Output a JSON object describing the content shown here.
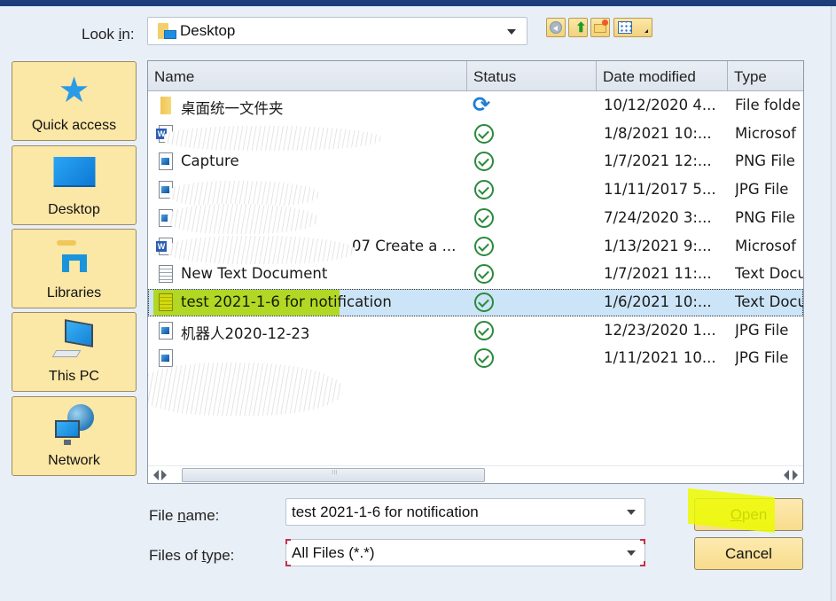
{
  "dialog": {
    "look_in": {
      "label_pre": "Look ",
      "label_u": "i",
      "label_post": "n:",
      "value": "Desktop",
      "icon": "desktop-folder-icon"
    },
    "toolbar": {
      "back_icon": "back-icon",
      "up_icon": "up-folder-icon",
      "new_folder_icon": "new-folder-icon",
      "view_menu_icon": "view-menu-icon"
    },
    "places": [
      {
        "label": "Quick access",
        "icon": "star-icon"
      },
      {
        "label": "Desktop",
        "icon": "desktop-icon"
      },
      {
        "label": "Libraries",
        "icon": "libraries-icon"
      },
      {
        "label": "This PC",
        "icon": "computer-icon"
      },
      {
        "label": "Network",
        "icon": "network-icon"
      }
    ],
    "columns": [
      "Name",
      "Status",
      "Date modified",
      "Type"
    ],
    "files": [
      {
        "name": "桌面统一文件夹",
        "icon": "folder",
        "status": "sync",
        "date": "10/12/2020 4...",
        "type": "File folde",
        "redacted": false
      },
      {
        "name": "",
        "icon": "doc",
        "status": "ok",
        "date": "1/8/2021 10:...",
        "type": "Microsof",
        "redacted": true
      },
      {
        "name": "Capture",
        "icon": "img",
        "status": "ok",
        "date": "1/7/2021 12:...",
        "type": "PNG File",
        "redacted": false
      },
      {
        "name": "",
        "icon": "img",
        "status": "ok",
        "date": "11/11/2017 5...",
        "type": "JPG File",
        "redacted": true
      },
      {
        "name": "",
        "icon": "img",
        "status": "ok",
        "date": "7/24/2020 3:...",
        "type": "PNG File",
        "redacted": true
      },
      {
        "name": "07 Create a ...",
        "icon": "doc",
        "status": "ok",
        "date": "1/13/2021 9:...",
        "type": "Microsof",
        "redacted": true
      },
      {
        "name": "New Text Document",
        "icon": "txt",
        "status": "ok",
        "date": "1/7/2021 11:...",
        "type": "Text Docu",
        "redacted": false
      },
      {
        "name": "test 2021-1-6 for notification",
        "icon": "txt",
        "status": "ok",
        "date": "1/6/2021 10:...",
        "type": "Text Docu",
        "redacted": false,
        "selected": true
      },
      {
        "name": "机器人2020-12-23",
        "icon": "img",
        "status": "ok",
        "date": "12/23/2020 1...",
        "type": "JPG File",
        "redacted": false
      },
      {
        "name": "",
        "icon": "img",
        "status": "ok",
        "date": "1/11/2021 10...",
        "type": "JPG File",
        "redacted": true
      }
    ],
    "file_name": {
      "label_pre": "File ",
      "label_u": "n",
      "label_post": "ame:",
      "value": "test 2021-1-6 for notification"
    },
    "file_type": {
      "label_pre": "Files of ",
      "label_u": "t",
      "label_post": "ype:",
      "value": "All Files (*.*)"
    },
    "buttons": {
      "open_u": "O",
      "open_rest": "pen",
      "cancel": "Cancel"
    },
    "highlight_color": "#d6f000",
    "selection_color": "#cce4f7",
    "status_ok_color": "#2a8a3b",
    "status_sync_color": "#1d7fd6"
  }
}
